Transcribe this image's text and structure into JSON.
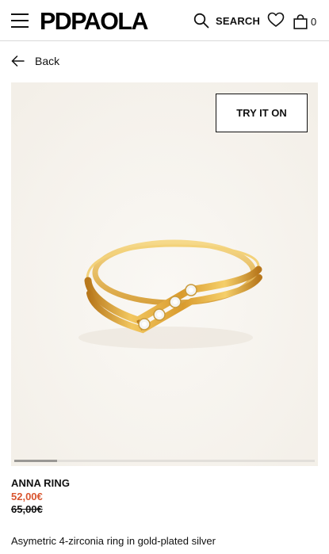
{
  "header": {
    "brand": "PDPAOLA",
    "search_label": "SEARCH",
    "cart_count": "0"
  },
  "nav": {
    "back_label": "Back"
  },
  "gallery": {
    "try_on_label": "TRY IT ON",
    "scroll_position": 0.0,
    "image_alt": "Anna ring"
  },
  "product": {
    "name": "ANNA RING",
    "price": "52,00€",
    "original_price": "65,00€",
    "description": "Asymetric 4-zirconia ring in gold-plated silver"
  },
  "colors": {
    "sale_price": "#d9552f",
    "text": "#111111",
    "gallery_bg": "#f6f3ee",
    "gold": "#e0a93a"
  }
}
